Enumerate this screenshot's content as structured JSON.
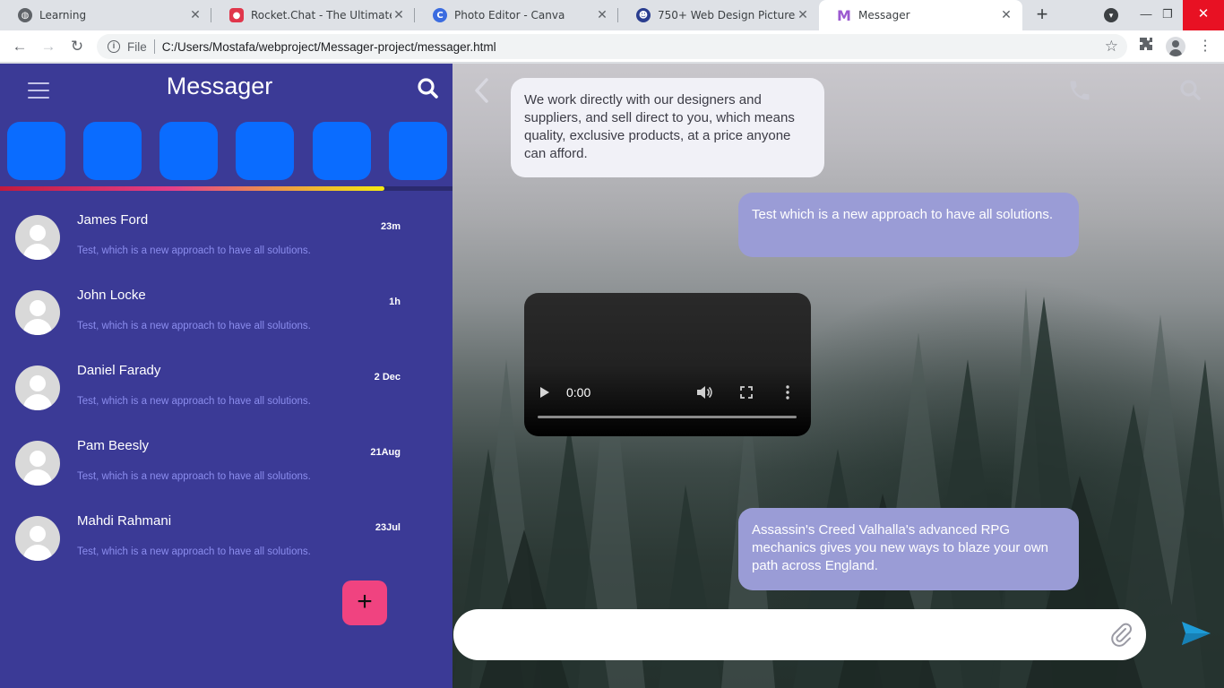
{
  "browser": {
    "tabs": [
      {
        "title": "Learning",
        "icon": "globe-icon",
        "active": false
      },
      {
        "title": "Rocket.Chat - The Ultimate Co",
        "icon": "rocketchat-icon",
        "active": false
      },
      {
        "title": "Photo Editor - Canva",
        "icon": "canva-icon",
        "active": false
      },
      {
        "title": "750+ Web Design Pictures | Do",
        "icon": "website-icon",
        "active": false
      },
      {
        "title": "Messager",
        "icon": "messager-icon",
        "active": true
      }
    ],
    "address": {
      "scheme_label": "File",
      "url": "C:/Users/Mostafa/webproject/Messager-project/messager.html"
    }
  },
  "app": {
    "title": "Messager",
    "stories_progress": 0.85,
    "contacts": [
      {
        "name": "James Ford",
        "message": "Test, which is a new approach to have all solutions.",
        "time": "23m"
      },
      {
        "name": "John Locke",
        "message": "Test, which is a new approach to have all solutions.",
        "time": "1h"
      },
      {
        "name": "Daniel Farady",
        "message": "Test, which is a new approach to have all solutions.",
        "time": "2 Dec"
      },
      {
        "name": "Pam Beesly",
        "message": "Test, which is a new approach to have all solutions.",
        "time": "21Aug"
      },
      {
        "name": "Mahdi Rahmani",
        "message": "Test, which is a new approach to have all solutions.",
        "time": "23Jul"
      }
    ],
    "fab_label": "+",
    "colors": {
      "sidebar": "#3b3a96",
      "story": "#0a6cff",
      "fab": "#f04380",
      "outgoing_bubble": "#9a9cd6",
      "incoming_bubble": "#f1f1f7",
      "send": "#1e9bd7"
    }
  },
  "chat": {
    "messages": [
      {
        "type": "incoming",
        "text": "We work directly with our designers and suppliers, and sell direct to you, which means quality, exclusive products, at a price anyone can afford."
      },
      {
        "type": "outgoing",
        "text": "Test which is a new approach to have all solutions."
      },
      {
        "type": "video",
        "time": "0:00"
      },
      {
        "type": "outgoing",
        "text": "Assassin's Creed Valhalla's advanced RPG mechanics gives you new ways to blaze your own path across England."
      }
    ],
    "compose": {
      "placeholder": ""
    }
  }
}
